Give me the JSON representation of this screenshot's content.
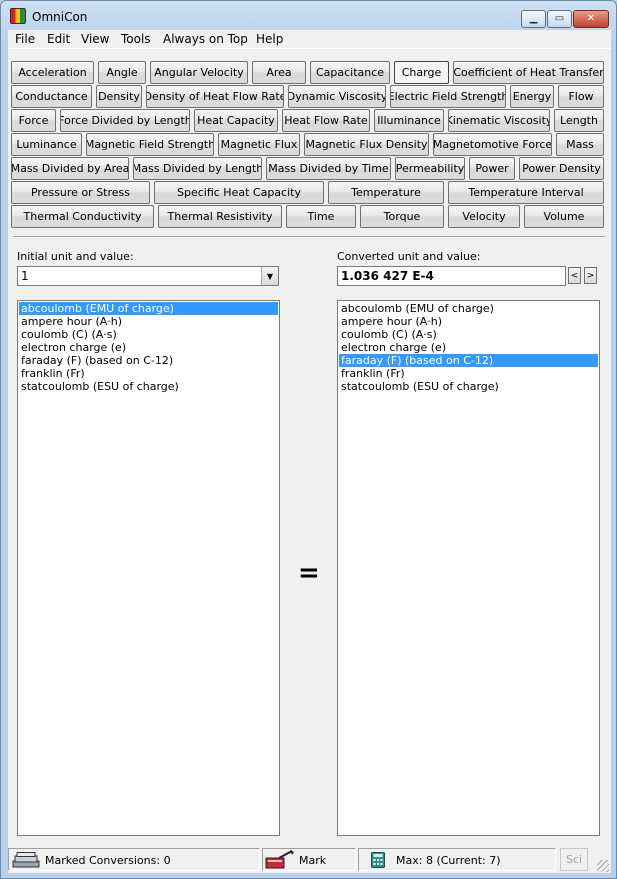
{
  "window": {
    "title": "OmniCon"
  },
  "menu": [
    "File",
    "Edit",
    "View",
    "Tools",
    "Always on Top",
    "Help"
  ],
  "categories": [
    "Acceleration",
    "Angle",
    "Angular Velocity",
    "Area",
    "Capacitance",
    "Charge",
    "Coefficient of Heat Transfer",
    "Conductance",
    "Density",
    "Density of Heat Flow Rate",
    "Dynamic Viscosity",
    "Electric Field Strength",
    "Energy",
    "Flow",
    "Force",
    "Force Divided by Length",
    "Heat Capacity",
    "Heat Flow Rate",
    "Illuminance",
    "Kinematic Viscosity",
    "Length",
    "Luminance",
    "Magnetic Field Strength",
    "Magnetic Flux",
    "Magnetic Flux Density",
    "Magnetomotive Force",
    "Mass",
    "Mass Divided by Area",
    "Mass Divided by Length",
    "Mass Divided by Time",
    "Permeability",
    "Power",
    "Power Density",
    "Pressure or Stress",
    "Specific Heat Capacity",
    "Temperature",
    "Temperature Interval",
    "Thermal Conductivity",
    "Thermal Resistivity",
    "Time",
    "Torque",
    "Velocity",
    "Volume"
  ],
  "selected_category": "Charge",
  "initial": {
    "label": "Initial unit and value:",
    "value": "1",
    "units": [
      "abcoulomb (EMU of charge)",
      "ampere hour (A·h)",
      "coulomb (C) (A·s)",
      "electron charge (e)",
      "faraday (F) (based on C-12)",
      "franklin (Fr)",
      "statcoulomb (ESU of charge)"
    ],
    "selected_unit": "abcoulomb (EMU of charge)"
  },
  "converted": {
    "label": "Converted unit and value:",
    "value": "1.036 427 E-4",
    "units": [
      "abcoulomb (EMU of charge)",
      "ampere hour (A·h)",
      "coulomb (C) (A·s)",
      "electron charge (e)",
      "faraday (F) (based on C-12)",
      "franklin (Fr)",
      "statcoulomb (ESU of charge)"
    ],
    "selected_unit": "faraday (F) (based on C-12)"
  },
  "equals_sign": "=",
  "status": {
    "marked": "Marked Conversions: 0",
    "mark_label": "Mark",
    "max": "Max: 8  (Current: 7)",
    "sci": "Sci"
  },
  "icons": {
    "app": "app-icon",
    "minimize": "minimize-icon",
    "maximize": "maximize-icon",
    "close": "close-icon",
    "dropdown": "chevron-down-icon",
    "prev": "chevron-left-icon",
    "next": "chevron-right-icon",
    "marked": "stack-icon",
    "mark": "mark-icon",
    "calculator": "calculator-icon"
  },
  "colors": {
    "selection": "#3399ff",
    "window_frame": "#b9d1ea"
  }
}
